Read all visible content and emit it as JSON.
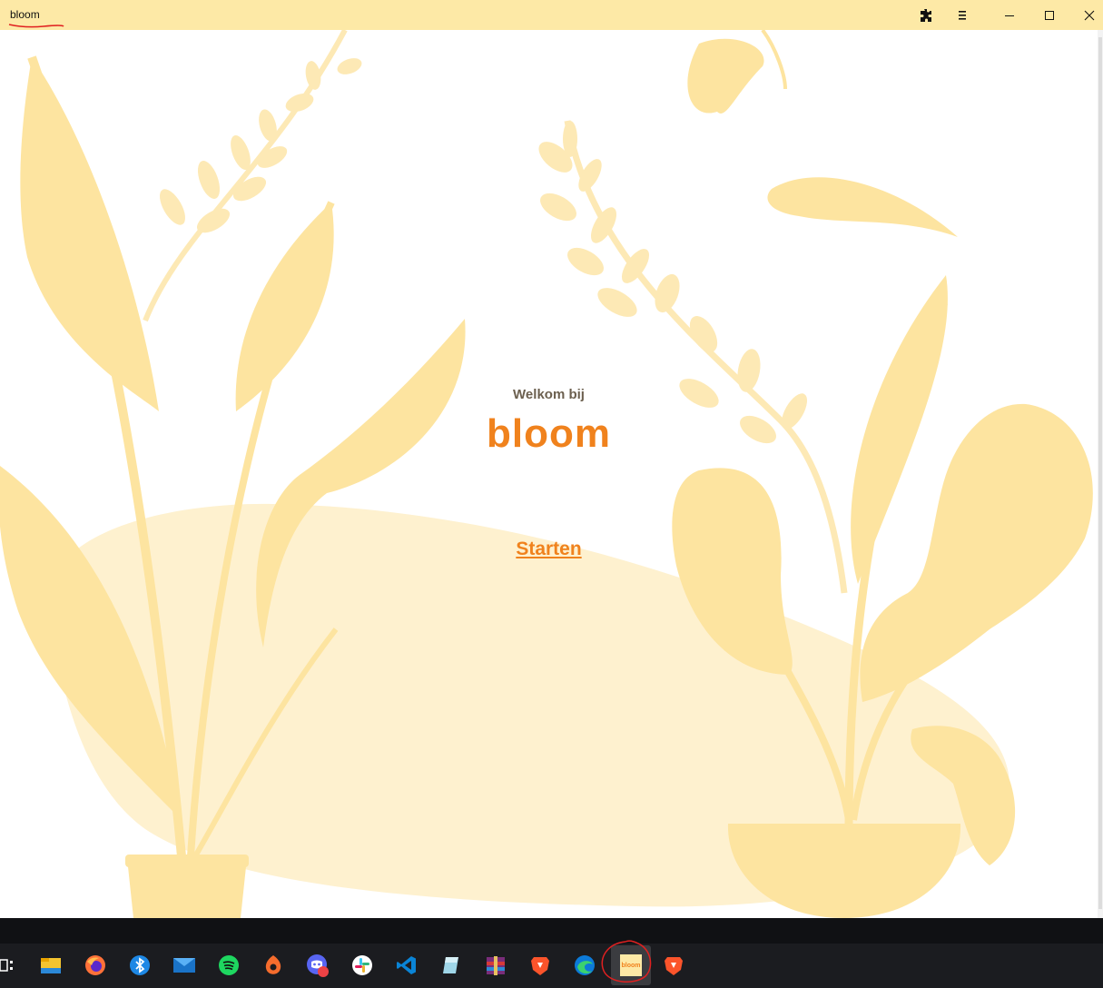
{
  "window": {
    "title": "bloom",
    "controls": [
      "extensions-icon",
      "menu-icon",
      "minimize-icon",
      "maximize-icon",
      "close-icon"
    ]
  },
  "main": {
    "welcome_text": "Welkom bij",
    "brand_name": "bloom",
    "start_link": "Starten"
  },
  "taskbar": {
    "items": [
      {
        "name": "task-view-icon"
      },
      {
        "name": "file-explorer-icon"
      },
      {
        "name": "firefox-icon"
      },
      {
        "name": "bluetooth-app-icon"
      },
      {
        "name": "mail-icon"
      },
      {
        "name": "spotify-icon"
      },
      {
        "name": "origin-icon"
      },
      {
        "name": "discord-icon",
        "badge": "9+"
      },
      {
        "name": "slack-icon"
      },
      {
        "name": "vscode-icon"
      },
      {
        "name": "eraser-app-icon"
      },
      {
        "name": "winrar-icon"
      },
      {
        "name": "brave-icon"
      },
      {
        "name": "edge-icon"
      },
      {
        "name": "bloom-app-icon",
        "label": "bloom",
        "active": true
      },
      {
        "name": "brave-icon-2"
      }
    ]
  },
  "colors": {
    "titlebar": "#fde9a6",
    "accent": "#f0821d",
    "plant": "#fde4a0",
    "plant_light": "#fef1cf",
    "taskbar": "#1b1c20"
  }
}
